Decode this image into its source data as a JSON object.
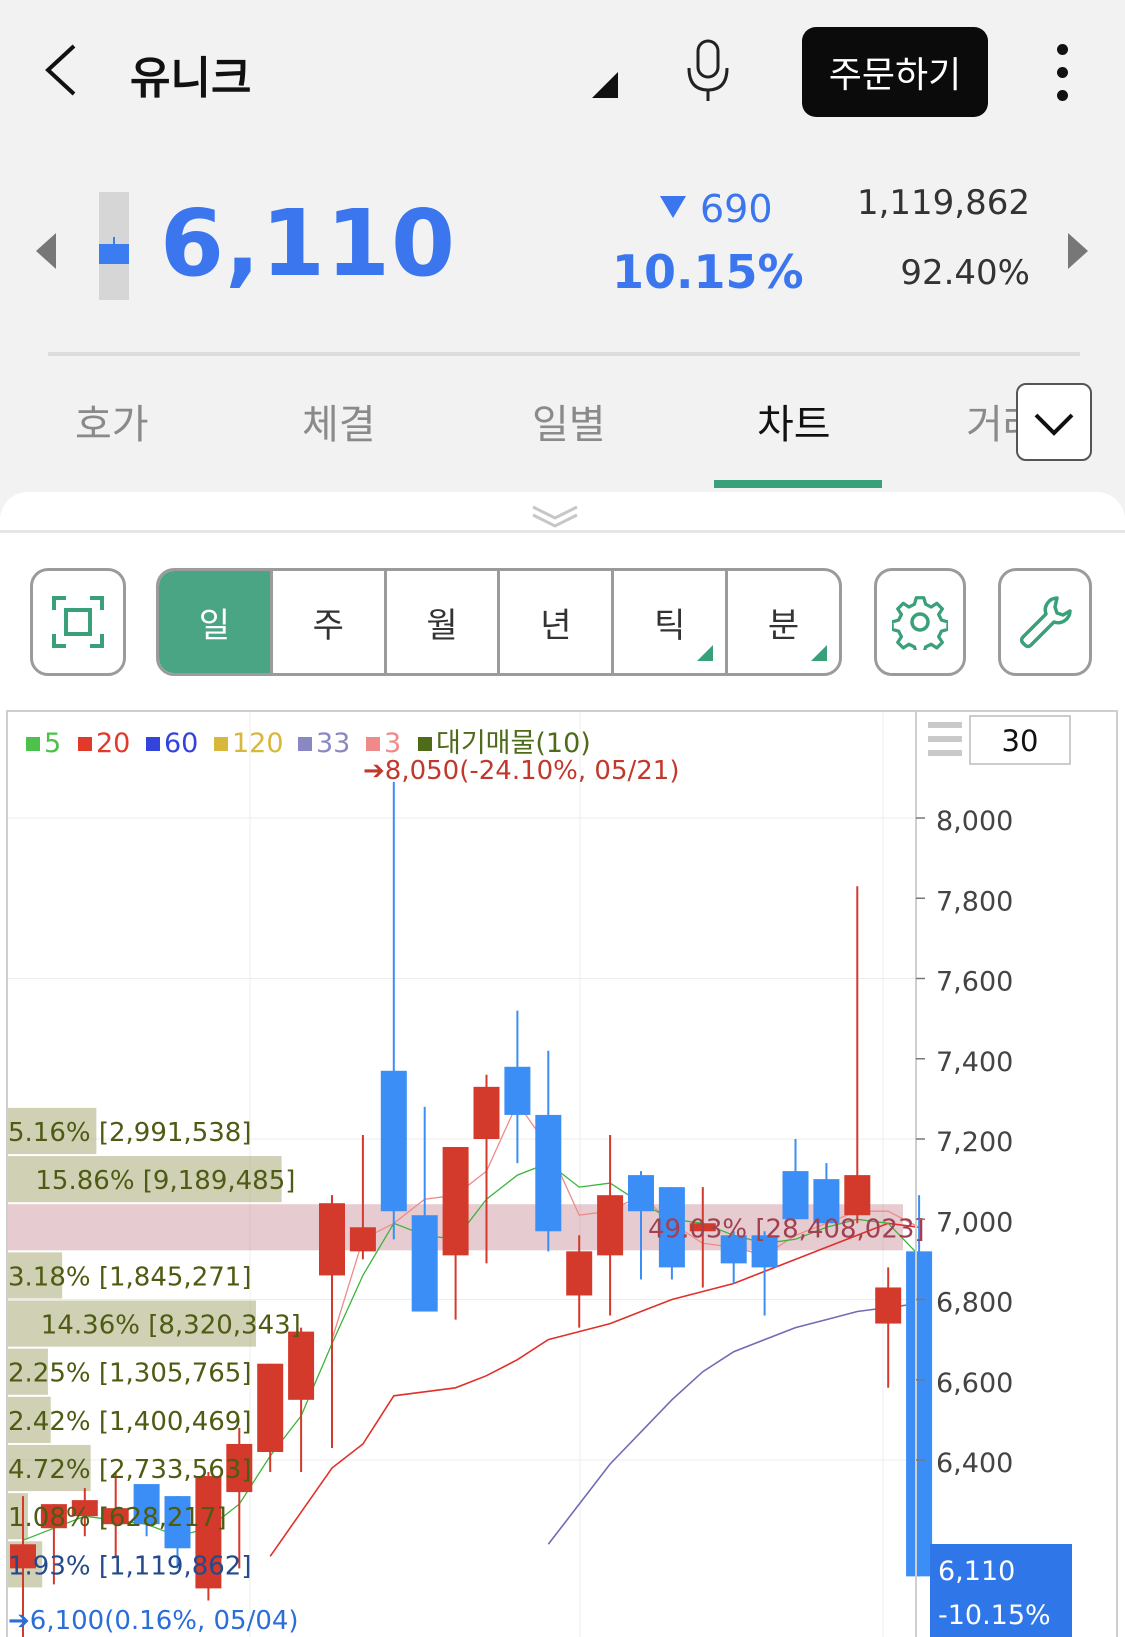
{
  "header": {
    "title": "유니크",
    "order_button": "주문하기"
  },
  "price": {
    "current": "6,110",
    "change": "690",
    "change_pct": "10.15%",
    "volume": "1,119,862",
    "volume_ratio": "92.40%"
  },
  "tabs": [
    {
      "label": "호가",
      "active": false
    },
    {
      "label": "체결",
      "active": false
    },
    {
      "label": "일별",
      "active": false
    },
    {
      "label": "차트",
      "active": true
    },
    {
      "label": "거래",
      "active": false
    }
  ],
  "periods": [
    {
      "label": "일",
      "active": true,
      "has_menu": false
    },
    {
      "label": "주",
      "active": false,
      "has_menu": false
    },
    {
      "label": "월",
      "active": false,
      "has_menu": false
    },
    {
      "label": "년",
      "active": false,
      "has_menu": false
    },
    {
      "label": "틱",
      "active": false,
      "has_menu": true
    },
    {
      "label": "분",
      "active": false,
      "has_menu": true
    }
  ],
  "toolbar": {
    "count": "30"
  },
  "colors": {
    "accent": "#4aa585",
    "down": "#3b7cf0",
    "up": "#d33a2c"
  },
  "chart_data": {
    "type": "candlestick",
    "y_range": [
      5930,
      8250
    ],
    "y_ticks": [
      {
        "value": 8000,
        "label": "8,000"
      },
      {
        "value": 7800,
        "label": "7,800"
      },
      {
        "value": 7600,
        "label": "7,600"
      },
      {
        "value": 7400,
        "label": "7,400"
      },
      {
        "value": 7200,
        "label": "7,200"
      },
      {
        "value": 7000,
        "label": "7,000"
      },
      {
        "value": 6800,
        "label": "6,800"
      },
      {
        "value": 6600,
        "label": "6,600"
      },
      {
        "value": 6400,
        "label": "6,400"
      }
    ],
    "legend": [
      {
        "label": "5",
        "color": "#4cc24c"
      },
      {
        "label": "20",
        "color": "#e23a2a"
      },
      {
        "label": "60",
        "color": "#3344dd"
      },
      {
        "label": "120",
        "color": "#d8b83c"
      },
      {
        "label": "33",
        "color": "#8a88c2"
      },
      {
        "label": "3",
        "color": "#f08a8a"
      },
      {
        "label": "대기매물(10)",
        "color": "#4e6b1a"
      }
    ],
    "high_annotation": "8,050(-24.10%, 05/21)",
    "low_annotation": "6,100(0.16%, 05/04)",
    "last": {
      "price": "6,110",
      "pct": "-10.15%"
    },
    "candles": [
      {
        "o": 6130,
        "h": 6310,
        "l": 5950,
        "c": 6190
      },
      {
        "o": 6230,
        "h": 6190,
        "l": 6090,
        "c": 6290
      },
      {
        "o": 6260,
        "h": 6330,
        "l": 6210,
        "c": 6300
      },
      {
        "o": 6240,
        "h": 6370,
        "l": 6160,
        "c": 6280
      },
      {
        "o": 6340,
        "h": 6220,
        "l": 6210,
        "c": 6240
      },
      {
        "o": 6310,
        "h": 6270,
        "l": 6130,
        "c": 6180
      },
      {
        "o": 6080,
        "h": 6370,
        "l": 6050,
        "c": 6360
      },
      {
        "o": 6320,
        "h": 6480,
        "l": 6130,
        "c": 6440
      },
      {
        "o": 6420,
        "h": 6580,
        "l": 6370,
        "c": 6640
      },
      {
        "o": 6550,
        "h": 6730,
        "l": 6370,
        "c": 6720
      },
      {
        "o": 6860,
        "h": 7060,
        "l": 6430,
        "c": 7040
      },
      {
        "o": 6920,
        "h": 7210,
        "l": 6900,
        "c": 6980
      },
      {
        "o": 7370,
        "h": 8090,
        "l": 6950,
        "c": 7020
      },
      {
        "o": 7010,
        "h": 7280,
        "l": 6960,
        "c": 6770
      },
      {
        "o": 6910,
        "h": 7020,
        "l": 6750,
        "c": 7180
      },
      {
        "o": 7200,
        "h": 7360,
        "l": 6890,
        "c": 7330
      },
      {
        "o": 7380,
        "h": 7520,
        "l": 7140,
        "c": 7260
      },
      {
        "o": 7260,
        "h": 7420,
        "l": 6920,
        "c": 6970
      },
      {
        "o": 6810,
        "h": 6960,
        "l": 6730,
        "c": 6920
      },
      {
        "o": 6910,
        "h": 7210,
        "l": 6760,
        "c": 7060
      },
      {
        "o": 7110,
        "h": 7120,
        "l": 6850,
        "c": 7020
      },
      {
        "o": 7080,
        "h": 7050,
        "l": 6850,
        "c": 6880
      },
      {
        "o": 6970,
        "h": 7080,
        "l": 6830,
        "c": 6990
      },
      {
        "o": 6960,
        "h": 6970,
        "l": 6840,
        "c": 6890
      },
      {
        "o": 6960,
        "h": 6970,
        "l": 6760,
        "c": 6880
      },
      {
        "o": 7120,
        "h": 7200,
        "l": 7080,
        "c": 7000
      },
      {
        "o": 7100,
        "h": 7140,
        "l": 7000,
        "c": 6990
      },
      {
        "o": 7010,
        "h": 7830,
        "l": 6990,
        "c": 7110
      },
      {
        "o": 6740,
        "h": 6880,
        "l": 6580,
        "c": 6830
      },
      {
        "o": 6920,
        "h": 7060,
        "l": 6910,
        "c": 6110
      }
    ],
    "ma_green": [
      6200,
      6230,
      6260,
      6250,
      6240,
      6210,
      6230,
      6290,
      6410,
      6510,
      6690,
      6860,
      6990,
      6960,
      6950,
      7050,
      7110,
      7140,
      7080,
      7090,
      7040,
      7000,
      6990,
      6960,
      6940,
      6950,
      6980,
      7000,
      6990,
      6910
    ],
    "ma_red": [
      null,
      null,
      null,
      null,
      null,
      null,
      null,
      null,
      6160,
      6270,
      6380,
      6440,
      6560,
      6570,
      6580,
      6610,
      6650,
      6700,
      6720,
      6740,
      6770,
      6800,
      6820,
      6840,
      6870,
      6900,
      6930,
      6960,
      6990,
      6980
    ],
    "ma_pink": [
      null,
      null,
      null,
      null,
      null,
      null,
      null,
      null,
      null,
      null,
      6700,
      6950,
      6990,
      7050,
      7060,
      7120,
      7290,
      7180,
      7010,
      7020,
      7060,
      6990,
      6940,
      6930,
      6910,
      6960,
      6990,
      7020,
      7020,
      6980
    ],
    "ma_purple": [
      null,
      null,
      null,
      null,
      null,
      null,
      null,
      null,
      null,
      null,
      null,
      null,
      null,
      null,
      null,
      null,
      null,
      6190,
      6290,
      6390,
      6470,
      6550,
      6620,
      6670,
      6700,
      6730,
      6750,
      6770,
      6780,
      6790
    ],
    "volume_profile": [
      {
        "label": "5.16% [2,991,538]",
        "width_frac": 0.31,
        "highlight": false
      },
      {
        "label": "15.86% [9,189,485]",
        "width_frac": 0.96,
        "highlight": false
      },
      {
        "label": "49.03% [28,408,023]",
        "width_frac": 1.0,
        "highlight": true
      },
      {
        "label": "3.18% [1,845,271]",
        "width_frac": 0.19,
        "highlight": false
      },
      {
        "label": "14.36% [8,320,343]",
        "width_frac": 0.87,
        "highlight": false
      },
      {
        "label": "2.25% [1,305,765]",
        "width_frac": 0.14,
        "highlight": false
      },
      {
        "label": "2.42% [1,400,469]",
        "width_frac": 0.15,
        "highlight": false
      },
      {
        "label": "4.72% [2,733,563]",
        "width_frac": 0.29,
        "highlight": false
      },
      {
        "label": "1.08% [628,217]",
        "width_frac": 0.07,
        "highlight": false
      },
      {
        "label": "1.93% [1,119,862]",
        "width_frac": 0.12,
        "highlight": false
      }
    ]
  }
}
